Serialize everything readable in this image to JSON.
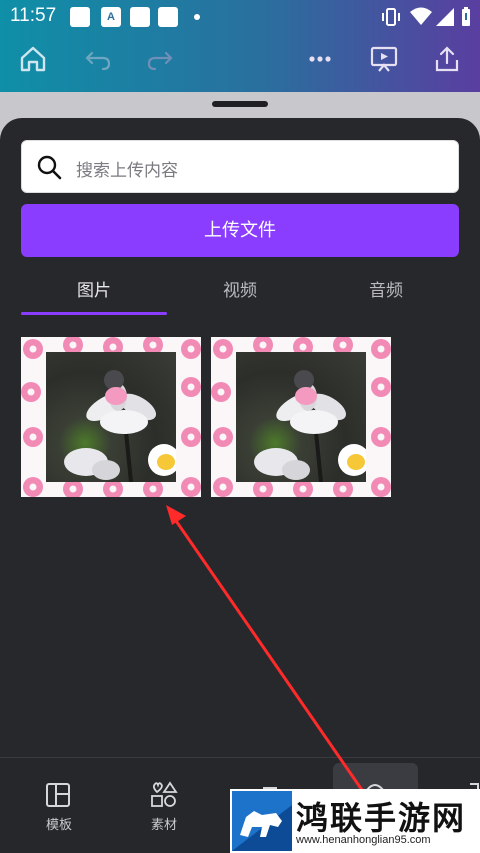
{
  "status_bar": {
    "time": "11:57",
    "notification_icon_letter": "A"
  },
  "toolbar": {
    "icons": [
      "home-icon",
      "undo-icon",
      "redo-icon",
      "more-icon",
      "present-icon",
      "share-icon"
    ]
  },
  "search": {
    "placeholder": "搜索上传内容"
  },
  "upload_button": {
    "label": "上传文件"
  },
  "tabs": [
    {
      "label": "图片",
      "active": true
    },
    {
      "label": "视频",
      "active": false
    },
    {
      "label": "音频",
      "active": false
    }
  ],
  "media_items": [
    {
      "type": "image",
      "description_icon": "flower-photo"
    },
    {
      "type": "image",
      "description_icon": "flower-photo"
    }
  ],
  "bottom_nav": [
    {
      "label": "模板",
      "icon": "template-icon"
    },
    {
      "label": "素材",
      "icon": "elements-icon"
    }
  ],
  "watermark": {
    "title": "鸿联手游网",
    "url": "www.henanhonglian95.com"
  },
  "colors": {
    "accent": "#8b3dff",
    "sheet": "#27282c",
    "annotation_arrow": "#ff2a2a"
  }
}
